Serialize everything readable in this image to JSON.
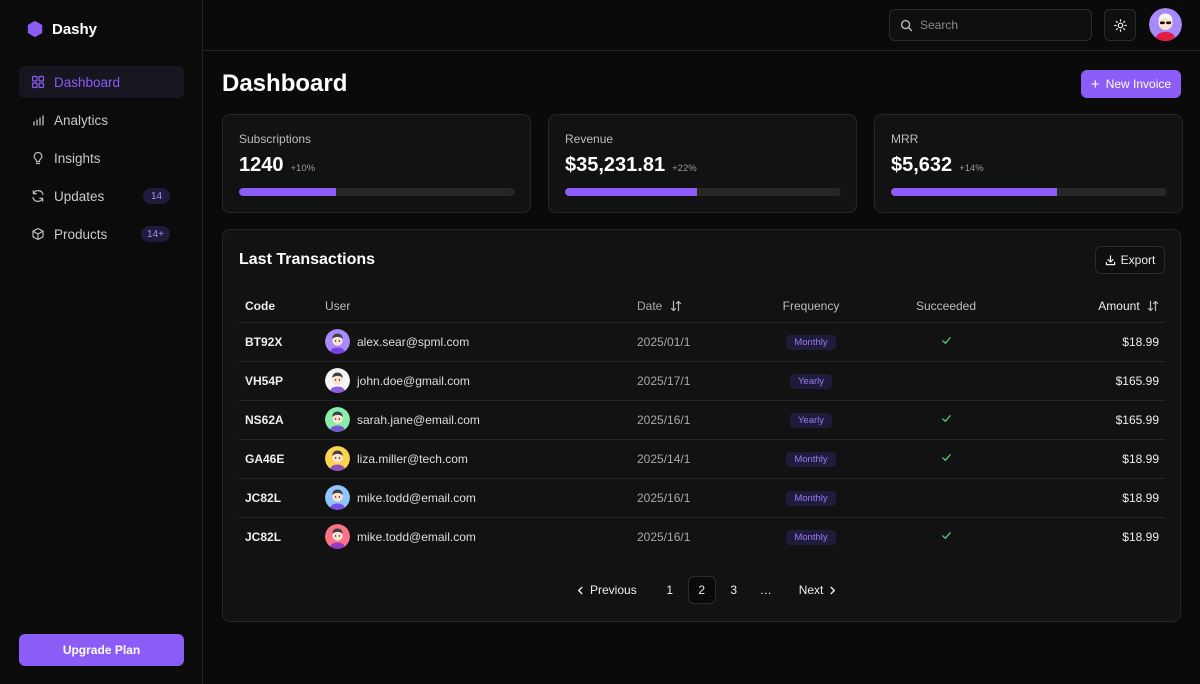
{
  "brand": {
    "name": "Dashy",
    "accent": "#8b5cf6"
  },
  "sidebar": {
    "items": [
      {
        "label": "Dashboard",
        "icon": "grid-icon",
        "active": true
      },
      {
        "label": "Analytics",
        "icon": "bar-chart-icon"
      },
      {
        "label": "Insights",
        "icon": "lightbulb-icon"
      },
      {
        "label": "Updates",
        "icon": "refresh-icon",
        "badge": "14"
      },
      {
        "label": "Products",
        "icon": "box-icon",
        "badge": "14+"
      }
    ],
    "upgrade_label": "Upgrade Plan"
  },
  "topbar": {
    "search_placeholder": "Search",
    "theme_icon": "sun-icon"
  },
  "page": {
    "title": "Dashboard",
    "new_invoice_label": "New Invoice"
  },
  "cards": [
    {
      "label": "Subscriptions",
      "value": "1240",
      "delta": "+10%",
      "progress": 35
    },
    {
      "label": "Revenue",
      "value": "$35,231.81",
      "delta": "+22%",
      "progress": 48
    },
    {
      "label": "MRR",
      "value": "$5,632",
      "delta": "+14%",
      "progress": 60
    }
  ],
  "transactions": {
    "title": "Last Transactions",
    "export_label": "Export",
    "columns": {
      "code": "Code",
      "user": "User",
      "date": "Date",
      "frequency": "Frequency",
      "succeeded": "Succeeded",
      "amount": "Amount"
    },
    "rows": [
      {
        "code": "BT92X",
        "user": "alex.sear@spml.com",
        "date": "2025/01/1",
        "frequency": "Monthly",
        "succeeded": true,
        "amount": "$18.99",
        "avatar_color": "#a78bfa"
      },
      {
        "code": "VH54P",
        "user": "john.doe@gmail.com",
        "date": "2025/17/1",
        "frequency": "Yearly",
        "succeeded": false,
        "amount": "$165.99",
        "avatar_color": "#f5f5f5"
      },
      {
        "code": "NS62A",
        "user": "sarah.jane@email.com",
        "date": "2025/16/1",
        "frequency": "Yearly",
        "succeeded": true,
        "amount": "$165.99",
        "avatar_color": "#86efac"
      },
      {
        "code": "GA46E",
        "user": "liza.miller@tech.com",
        "date": "2025/14/1",
        "frequency": "Monthly",
        "succeeded": true,
        "amount": "$18.99",
        "avatar_color": "#fcd34d"
      },
      {
        "code": "JC82L",
        "user": "mike.todd@email.com",
        "date": "2025/16/1",
        "frequency": "Monthly",
        "succeeded": false,
        "amount": "$18.99",
        "avatar_color": "#93c5fd"
      },
      {
        "code": "JC82L",
        "user": "mike.todd@email.com",
        "date": "2025/16/1",
        "frequency": "Monthly",
        "succeeded": true,
        "amount": "$18.99",
        "avatar_color": "#fb7185"
      }
    ]
  },
  "pagination": {
    "previous_label": "Previous",
    "next_label": "Next",
    "pages": [
      "1",
      "2",
      "3"
    ],
    "current": "2",
    "ellipsis": "…"
  },
  "colors": {
    "success": "#4ade80",
    "badge_bg": "#1f1b3a",
    "badge_text": "#9b7bf5"
  }
}
